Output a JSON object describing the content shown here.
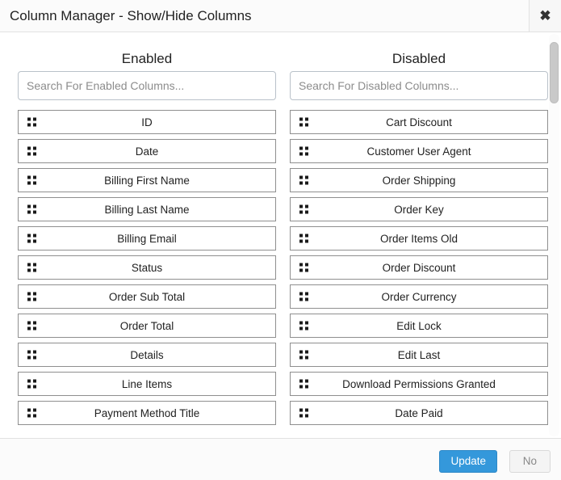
{
  "window": {
    "title": "Column Manager - Show/Hide Columns",
    "close_icon": "close-icon",
    "close_glyph": "✖"
  },
  "enabled": {
    "heading": "Enabled",
    "search_placeholder": "Search For Enabled Columns...",
    "search_value": "",
    "items": [
      "ID",
      "Date",
      "Billing First Name",
      "Billing Last Name",
      "Billing Email",
      "Status",
      "Order Sub Total",
      "Order Total",
      "Details",
      "Line Items",
      "Payment Method Title"
    ]
  },
  "disabled": {
    "heading": "Disabled",
    "search_placeholder": "Search For Disabled Columns...",
    "search_value": "",
    "items": [
      "Cart Discount",
      "Customer User Agent",
      "Order Shipping",
      "Order Key",
      "Order Items Old",
      "Order Discount",
      "Order Currency",
      "Edit Lock",
      "Edit Last",
      "Download Permissions Granted",
      "Date Paid"
    ]
  },
  "footer": {
    "update_label": "Update",
    "no_label": "No"
  },
  "colors": {
    "primary": "#3498db",
    "primary_border": "#2e88c7",
    "titlebar_bg": "#fbfbfb",
    "item_border": "#8f8f8f",
    "input_border": "#b9c1c9",
    "scrollbar_thumb": "#c9c9c9"
  },
  "icons": {
    "drag_handle": "drag-handle-icon"
  }
}
